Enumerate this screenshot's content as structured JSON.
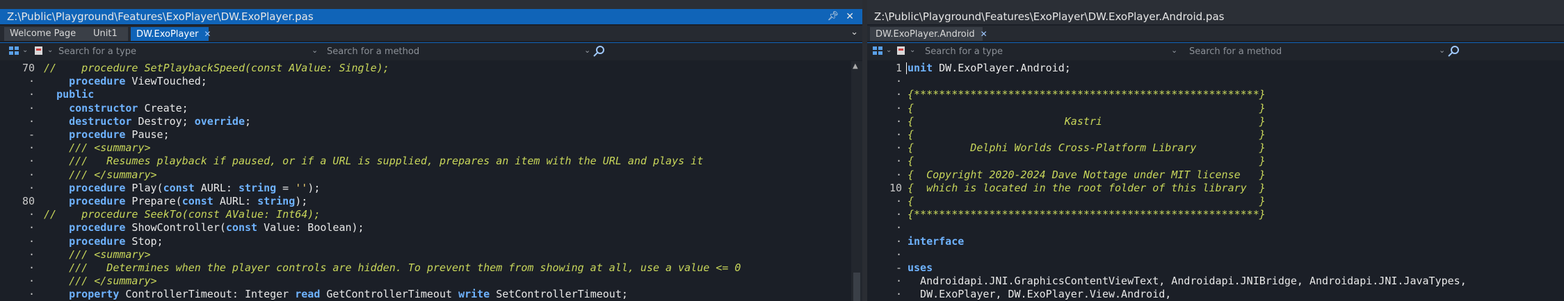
{
  "left": {
    "title": "Z:\\Public\\Playground\\Features\\ExoPlayer\\DW.ExoPlayer.pas",
    "pin_icon": "pin-icon",
    "close_icon": "close-icon",
    "tabs": [
      {
        "label": "Welcome Page",
        "active": false
      },
      {
        "label": "Unit1",
        "active": false
      },
      {
        "label": "DW.ExoPlayer",
        "active": true,
        "close": "✕"
      }
    ],
    "search_type_placeholder": "Search for a type",
    "search_method_placeholder": "Search for a method",
    "lines": [
      {
        "g": "70",
        "h": [
          [
            "cm",
            "//    procedure SetPlaybackSpeed(const AValue: Single);"
          ]
        ]
      },
      {
        "g": "·",
        "h": [
          [
            "sp",
            "    "
          ],
          [
            "kw",
            "procedure"
          ],
          [
            "tx",
            " ViewTouched;"
          ]
        ]
      },
      {
        "g": "·",
        "h": [
          [
            "sp",
            "  "
          ],
          [
            "kw",
            "public"
          ]
        ]
      },
      {
        "g": "·",
        "h": [
          [
            "sp",
            "    "
          ],
          [
            "kw",
            "constructor"
          ],
          [
            "tx",
            " Create;"
          ]
        ]
      },
      {
        "g": "·",
        "h": [
          [
            "sp",
            "    "
          ],
          [
            "kw",
            "destructor"
          ],
          [
            "tx",
            " Destroy; "
          ],
          [
            "kw",
            "override"
          ],
          [
            "tx",
            ";"
          ]
        ]
      },
      {
        "g": "-",
        "h": [
          [
            "sp",
            "    "
          ],
          [
            "kw",
            "procedure"
          ],
          [
            "tx",
            " Pause;"
          ]
        ]
      },
      {
        "g": "·",
        "h": [
          [
            "sp",
            "    "
          ],
          [
            "cm",
            "/// <summary>"
          ]
        ]
      },
      {
        "g": "·",
        "h": [
          [
            "sp",
            "    "
          ],
          [
            "cm",
            "///   Resumes playback if paused, or if a URL is supplied, prepares an item with the URL and plays it"
          ]
        ]
      },
      {
        "g": "·",
        "h": [
          [
            "sp",
            "    "
          ],
          [
            "cm",
            "/// </summary>"
          ]
        ]
      },
      {
        "g": "·",
        "h": [
          [
            "sp",
            "    "
          ],
          [
            "kw",
            "procedure"
          ],
          [
            "tx",
            " Play("
          ],
          [
            "kw",
            "const"
          ],
          [
            "tx",
            " AURL: "
          ],
          [
            "kw",
            "string"
          ],
          [
            "tx",
            " = "
          ],
          [
            "st",
            "''"
          ],
          [
            "tx",
            ");"
          ]
        ]
      },
      {
        "g": "80",
        "h": [
          [
            "sp",
            "    "
          ],
          [
            "kw",
            "procedure"
          ],
          [
            "tx",
            " Prepare("
          ],
          [
            "kw",
            "const"
          ],
          [
            "tx",
            " AURL: "
          ],
          [
            "kw",
            "string"
          ],
          [
            "tx",
            ");"
          ]
        ]
      },
      {
        "g": "·",
        "h": [
          [
            "cm",
            "//    procedure SeekTo(const AValue: Int64);"
          ]
        ]
      },
      {
        "g": "·",
        "h": [
          [
            "sp",
            "    "
          ],
          [
            "kw",
            "procedure"
          ],
          [
            "tx",
            " ShowController("
          ],
          [
            "kw",
            "const"
          ],
          [
            "tx",
            " Value: Boolean);"
          ]
        ]
      },
      {
        "g": "·",
        "h": [
          [
            "sp",
            "    "
          ],
          [
            "kw",
            "procedure"
          ],
          [
            "tx",
            " Stop;"
          ]
        ]
      },
      {
        "g": "·",
        "h": [
          [
            "sp",
            "    "
          ],
          [
            "cm",
            "/// <summary>"
          ]
        ]
      },
      {
        "g": "·",
        "h": [
          [
            "sp",
            "    "
          ],
          [
            "cm",
            "///   Determines when the player controls are hidden. To prevent them from showing at all, use a value <= 0"
          ]
        ]
      },
      {
        "g": "·",
        "h": [
          [
            "sp",
            "    "
          ],
          [
            "cm",
            "/// </summary>"
          ]
        ]
      },
      {
        "g": "·",
        "h": [
          [
            "sp",
            "    "
          ],
          [
            "kw",
            "property"
          ],
          [
            "tx",
            " ControllerTimeout: Integer "
          ],
          [
            "kw",
            "read"
          ],
          [
            "tx",
            " GetControllerTimeout "
          ],
          [
            "kw",
            "write"
          ],
          [
            "tx",
            " SetControllerTimeout;"
          ]
        ]
      }
    ]
  },
  "right": {
    "title": "Z:\\Public\\Playground\\Features\\ExoPlayer\\DW.ExoPlayer.Android.pas",
    "tabs": [
      {
        "label": "DW.ExoPlayer.Android",
        "active": false,
        "close": "✕"
      }
    ],
    "search_type_placeholder": "Search for a type",
    "search_method_placeholder": "Search for a method",
    "lines": [
      {
        "g": "1",
        "h": [
          [
            "kw",
            "unit"
          ],
          [
            "tx",
            " DW.ExoPlayer.Android;"
          ]
        ]
      },
      {
        "g": "·",
        "h": []
      },
      {
        "g": "·",
        "h": [
          [
            "cm",
            "{*******************************************************}"
          ]
        ]
      },
      {
        "g": "·",
        "h": [
          [
            "cm",
            "{                                                       }"
          ]
        ]
      },
      {
        "g": "·",
        "h": [
          [
            "cm",
            "{                        Kastri                         }"
          ]
        ]
      },
      {
        "g": "·",
        "h": [
          [
            "cm",
            "{                                                       }"
          ]
        ]
      },
      {
        "g": "·",
        "h": [
          [
            "cm",
            "{         Delphi Worlds Cross-Platform Library          }"
          ]
        ]
      },
      {
        "g": "·",
        "h": [
          [
            "cm",
            "{                                                       }"
          ]
        ]
      },
      {
        "g": "·",
        "h": [
          [
            "cm",
            "{  Copyright 2020-2024 Dave Nottage under MIT license   }"
          ]
        ]
      },
      {
        "g": "10",
        "h": [
          [
            "cm",
            "{  which is located in the root folder of this library  }"
          ]
        ]
      },
      {
        "g": "·",
        "h": [
          [
            "cm",
            "{                                                       }"
          ]
        ]
      },
      {
        "g": "·",
        "h": [
          [
            "cm",
            "{*******************************************************}"
          ]
        ]
      },
      {
        "g": "·",
        "h": []
      },
      {
        "g": "·",
        "h": [
          [
            "kw",
            "interface"
          ]
        ]
      },
      {
        "g": "·",
        "h": []
      },
      {
        "g": "-",
        "h": [
          [
            "kw",
            "uses"
          ]
        ]
      },
      {
        "g": "·",
        "h": [
          [
            "tx",
            "  Androidapi.JNI.GraphicsContentViewText, Androidapi.JNIBridge, Androidapi.JNI.JavaTypes,"
          ]
        ]
      },
      {
        "g": "·",
        "h": [
          [
            "tx",
            "  DW.ExoPlayer, DW.ExoPlayer.View.Android,"
          ]
        ]
      }
    ]
  }
}
